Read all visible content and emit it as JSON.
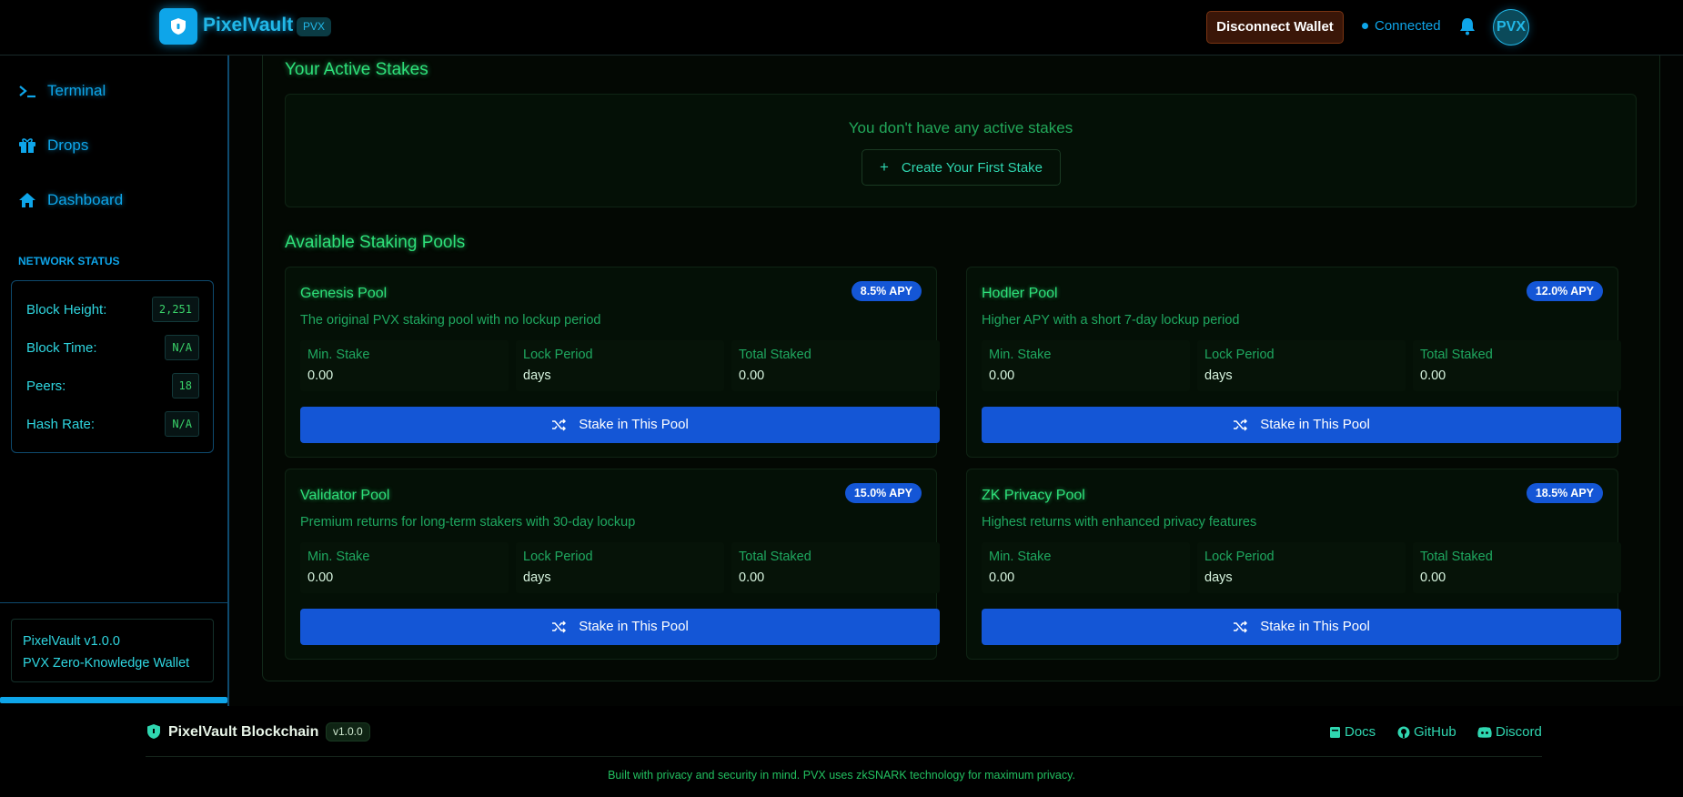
{
  "header": {
    "brand": "PixelVault",
    "badge": "PVX",
    "disconnect_label": "Disconnect  Wallet",
    "connection_status": "Connected",
    "avatar_text": "PVX"
  },
  "sidebar": {
    "items": [
      {
        "label": "Terminal",
        "icon": "terminal-icon"
      },
      {
        "label": "Drops",
        "icon": "gift-icon"
      },
      {
        "label": "Dashboard",
        "icon": "home-icon"
      }
    ],
    "network_title": "NETWORK STATUS",
    "network": [
      {
        "label": "Block Height:",
        "value": "2,251"
      },
      {
        "label": "Block Time:",
        "value": "N/A"
      },
      {
        "label": "Peers:",
        "value": "18"
      },
      {
        "label": "Hash Rate:",
        "value": "N/A"
      }
    ],
    "version": "PixelVault v1.0.0",
    "tagline": "PVX Zero-Knowledge Wallet"
  },
  "stakes": {
    "title": "Your Active Stakes",
    "empty_text": "You don't have any active stakes",
    "create_label": "Create Your First Stake"
  },
  "pools_title": "Available Staking Pools",
  "pools": [
    {
      "name": "Genesis Pool",
      "apy": "8.5% APY",
      "desc": "The original PVX staking pool with no lockup period",
      "min_label": "Min. Stake",
      "min": "0.00",
      "lock_label": "Lock Period",
      "lock": "days",
      "total_label": "Total Staked",
      "total": "0.00",
      "button": "Stake in This Pool"
    },
    {
      "name": "Hodler Pool",
      "apy": "12.0% APY",
      "desc": "Higher APY with a short 7-day lockup period",
      "min_label": "Min. Stake",
      "min": "0.00",
      "lock_label": "Lock Period",
      "lock": "days",
      "total_label": "Total Staked",
      "total": "0.00",
      "button": "Stake in This Pool"
    },
    {
      "name": "Validator Pool",
      "apy": "15.0% APY",
      "desc": "Premium returns for long-term stakers with 30-day lockup",
      "min_label": "Min. Stake",
      "min": "0.00",
      "lock_label": "Lock Period",
      "lock": "days",
      "total_label": "Total Staked",
      "total": "0.00",
      "button": "Stake in This Pool"
    },
    {
      "name": "ZK Privacy Pool",
      "apy": "18.5% APY",
      "desc": "Highest returns with enhanced privacy features",
      "min_label": "Min. Stake",
      "min": "0.00",
      "lock_label": "Lock Period",
      "lock": "days",
      "total_label": "Total Staked",
      "total": "0.00",
      "button": "Stake in This Pool"
    }
  ],
  "footer": {
    "brand": "PixelVault Blockchain",
    "version": "v1.0.0",
    "links": [
      "Docs",
      "GitHub",
      "Discord"
    ],
    "note": "Built with privacy and security in mind. PVX uses zkSNARK technology for maximum privacy."
  },
  "colors": {
    "accent": "#0ea5e9",
    "green": "#2ee07a",
    "button": "#1456d6",
    "disconnect": "#3a1608"
  }
}
